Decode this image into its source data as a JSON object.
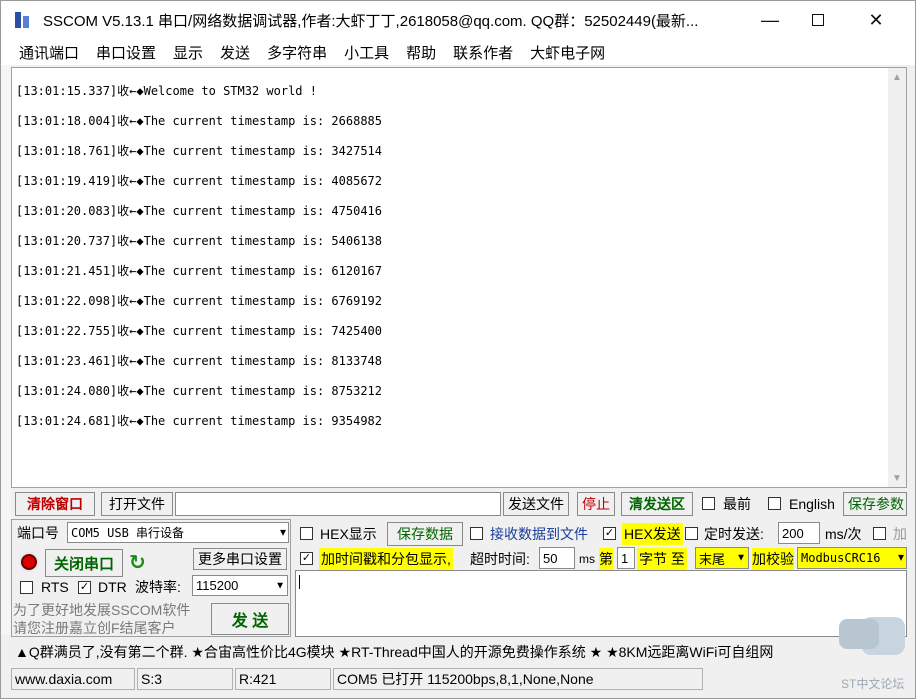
{
  "window": {
    "title": "SSCOM V5.13.1 串口/网络数据调试器,作者:大虾丁丁,2618058@qq.com. QQ群：52502449(最新...",
    "minimize": "—",
    "close": "✕"
  },
  "menu": [
    "通讯端口",
    "串口设置",
    "显示",
    "发送",
    "多字符串",
    "小工具",
    "帮助",
    "联系作者",
    "大虾电子网"
  ],
  "receive": {
    "lines": [
      "[13:01:15.337]收←◆Welcome to STM32 world !",
      "[13:01:18.004]收←◆The current timestamp is: 2668885",
      "[13:01:18.761]收←◆The current timestamp is: 3427514",
      "[13:01:19.419]收←◆The current timestamp is: 4085672",
      "[13:01:20.083]收←◆The current timestamp is: 4750416",
      "[13:01:20.737]收←◆The current timestamp is: 5406138",
      "[13:01:21.451]收←◆The current timestamp is: 6120167",
      "[13:01:22.098]收←◆The current timestamp is: 6769192",
      "[13:01:22.755]收←◆The current timestamp is: 7425400",
      "[13:01:23.461]收←◆The current timestamp is: 8133748",
      "[13:01:24.080]收←◆The current timestamp is: 8753212",
      "[13:01:24.681]收←◆The current timestamp is: 9354982"
    ]
  },
  "toolbar": {
    "clear_window": "清除窗口",
    "open_file": "打开文件",
    "file_path": "",
    "send_file": "发送文件",
    "stop": "停止",
    "clear_send": "清发送区",
    "frontmost": "最前",
    "english": "English",
    "save_params": "保存参数"
  },
  "port": {
    "label": "端口号",
    "value": "COM5 USB 串行设备",
    "close_port": "关闭串口",
    "more_settings": "更多串口设置",
    "rts": "RTS",
    "dtr": "DTR",
    "baud_label": "波特率:",
    "baud_value": "115200"
  },
  "options": {
    "hex_display": "HEX显示",
    "save_data": "保存数据",
    "recv_to_file": "接收数据到文件",
    "hex_send": "HEX发送",
    "timed_send": "定时发送:",
    "timed_value": "200",
    "timed_unit": "ms/次",
    "add_label": "加",
    "timestamp": "加时间戳和分包显示,",
    "timeout_label": "超时时间:",
    "timeout_value": "50",
    "timeout_unit": "ms",
    "byte_prefix": "第",
    "byte_index": "1",
    "byte_label": "字节 至",
    "byte_end": "末尾",
    "checksum_label": "加校验",
    "checksum_value": "ModbusCRC16"
  },
  "promo": {
    "line1": "为了更好地发展SSCOM软件",
    "line2": "请您注册嘉立创F结尾客户",
    "send": "发 送"
  },
  "adbar": "▲Q群满员了,没有第二个群. ★合宙高性价比4G模块 ★RT-Thread中国人的开源免费操作系统 ★ ★8KM远距离WiFi可自组网",
  "status": {
    "site": "www.daxia.com",
    "sent": "S:3",
    "recv": "R:421",
    "port_state": "COM5 已打开  115200bps,8,1,None,None"
  },
  "watermark": "ST中文论坛"
}
